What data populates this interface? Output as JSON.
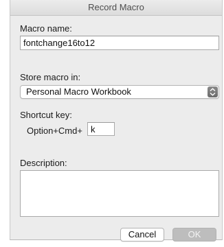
{
  "window": {
    "title": "Record Macro"
  },
  "macro_name": {
    "label": "Macro name:",
    "value": "fontchange16to12"
  },
  "store_in": {
    "label": "Store macro in:",
    "selected": "Personal Macro Workbook"
  },
  "shortcut": {
    "label": "Shortcut key:",
    "modifier": "Option+Cmd+",
    "key": "k"
  },
  "description": {
    "label": "Description:",
    "value": ""
  },
  "buttons": {
    "cancel": "Cancel",
    "ok": "OK"
  }
}
